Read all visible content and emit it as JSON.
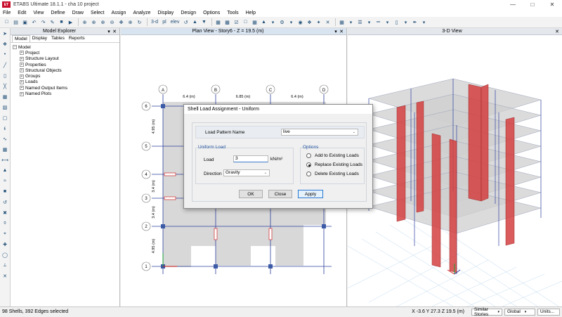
{
  "window": {
    "title": "ETABS Ultimate 18.1.1 - cha 10 project",
    "logo_text": "ET"
  },
  "menu": [
    "File",
    "Edit",
    "View",
    "Define",
    "Draw",
    "Select",
    "Assign",
    "Analyze",
    "Display",
    "Design",
    "Options",
    "Tools",
    "Help"
  ],
  "toolbar": {
    "view_3d_label": "3-d",
    "view_pl_label": "pl",
    "view_elev_label": "elev"
  },
  "explorer": {
    "title": "Model Explorer",
    "tabs": [
      "Model",
      "Display",
      "Tables",
      "Reports"
    ],
    "active_tab": "Model",
    "root": "Model",
    "items": [
      "Project",
      "Structure Layout",
      "Properties",
      "Structural Objects",
      "Groups",
      "Loads",
      "Named Output Items",
      "Named Plots"
    ]
  },
  "plan_view": {
    "title": "Plan View - Story6 - Z = 19.5 (m)",
    "grid_columns": [
      "A",
      "B",
      "C",
      "D"
    ],
    "grid_rows": [
      "6",
      "5",
      "4",
      "3",
      "2",
      "1"
    ],
    "spacings_x": [
      "6.4 (m)",
      "6.85 (m)",
      "6.4 (m)"
    ],
    "spacings_y": [
      "4.95 (m)",
      "3.4 (m)",
      "3.4 (m)",
      "4.95 (m)"
    ]
  },
  "view_3d": {
    "title": "3-D View"
  },
  "dialog": {
    "title": "Shell Load Assignment - Uniform",
    "load_pattern_label": "Load Pattern Name",
    "load_pattern_value": "live",
    "uniform_group_label": "Uniform Load",
    "load_label": "Load",
    "load_value": "3",
    "load_unit": "kN/m²",
    "direction_label": "Direction",
    "direction_value": "Gravity",
    "options_group_label": "Options",
    "options": [
      "Add to Existing Loads",
      "Replace Existing Loads",
      "Delete Existing Loads"
    ],
    "selected_option": 1,
    "buttons": {
      "ok": "OK",
      "close": "Close",
      "apply": "Apply"
    }
  },
  "status": {
    "selection": "98 Shells, 392 Edges selected",
    "coords": "X -3.6  Y 27.3  Z 19.5 (m)",
    "stories": "Similar Stories",
    "coord_system": "Global",
    "units": "Units..."
  },
  "colors": {
    "accent": "#c8102e",
    "grid_blue": "#2d3f9e",
    "slab_gray": "#d8d8d8",
    "wall_red": "#d43f3f"
  }
}
